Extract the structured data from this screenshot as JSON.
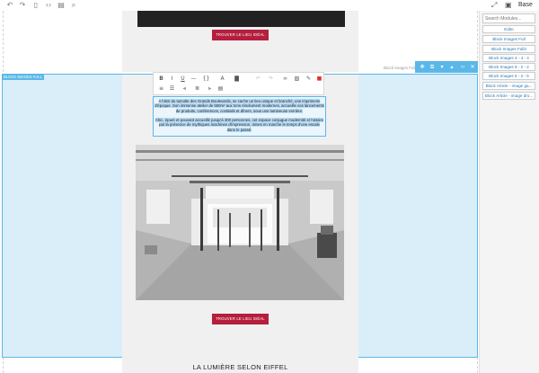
{
  "toolbar": {
    "icons": [
      "undo-icon",
      "redo-icon",
      "file-icon",
      "code-icon",
      "clipboard-icon",
      "search-icon",
      "fullscreen-icon",
      "save-icon"
    ],
    "mode_label": "Base"
  },
  "canvas": {
    "cta_top": "TROUVER LE LIEU IDÉAL",
    "cta_bottom": "TROUVER LE LIEU IDÉAL",
    "bottom_title": "LA LUMIÈRE SELON EIFFEL"
  },
  "block": {
    "label": "BLOCK IMAGES FULL",
    "name_right": "Block Images Full"
  },
  "text": {
    "para1": "A l'abri du tumulte des Grands Boulevards, se cache un lieu unique et branché, une imprimerie d'époque. Son immense atelier de 650m² aux tons résolument modernes, accueille vos lancements de produits, conférences, cocktails et dîners, sous une lumineuse verrière.",
    "para2": "Chic, épuré et pouvant accueillir jusqu'à 300 personnes, cet espace conjugue modernité et histoire par la présence de mythiques machines d'impression, mises en marche le temps d'une escale dans le passé."
  },
  "sidebar": {
    "search_placeholder": "Search Modules...",
    "modules": [
      "Edito",
      "Block Images Full",
      "Block Images Full2",
      "Block Images 4 - 4 - 4",
      "Block Images 8 - 2 - 2",
      "Block Images 5 - 2 - 5",
      "Block Article - image ga...",
      "Block Article - image dro..."
    ]
  },
  "colors": {
    "accent": "#5ab8e8",
    "cta": "#b51e3c",
    "selection": "#daeefa"
  }
}
